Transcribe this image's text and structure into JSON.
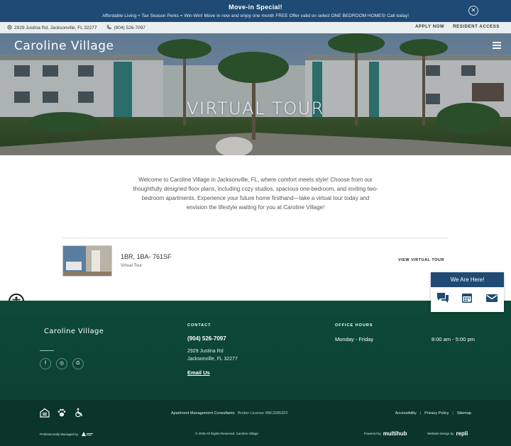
{
  "announcement": {
    "title": "Move-in Special!",
    "text": "Affordable Living + Tax Season Perks = Win-Win! Move in now and enjoy one month FREE Offer valid on select ONE BEDROOM HOMES! Call today!",
    "close_icon": "close-icon",
    "close_glyph": "✕"
  },
  "utility": {
    "address": "2929 Justina Rd, Jacksonville, FL 32277",
    "phone": "(904) 526-7097",
    "apply": "APPLY NOW",
    "resident": "RESIDENT ACCESS"
  },
  "header": {
    "brand": "Caroline Village",
    "menu_icon": "hamburger-menu-icon"
  },
  "hero": {
    "title": "VIRTUAL TOUR"
  },
  "intro": {
    "text": "Welcome to Caroline Village in Jacksonville, FL, where comfort meets style! Choose from our thoughtfully designed floor plans, including cozy studios, spacious one-bedroom, and inviting two-bedroom apartments. Experience your future home firsthand—take a virtual tour today and envision the lifestyle waiting for you at Caroline Village!"
  },
  "tours": [
    {
      "name": "1BR, 1BA- 761SF",
      "subtitle": "Virtual Tour",
      "link": "VIEW VIRTUAL TOUR"
    }
  ],
  "chat": {
    "header": "We Are Here!",
    "icons": [
      "chat-icon",
      "calendar-icon",
      "mail-icon"
    ]
  },
  "footer": {
    "brand": "Caroline Village",
    "social": [
      "facebook-icon",
      "instagram-icon",
      "google-icon"
    ],
    "social_glyphs": [
      "f",
      "◎",
      "G"
    ],
    "contact": {
      "heading": "CONTACT",
      "phone": "(904) 526-7097",
      "address_line1": "2929 Justina Rd",
      "address_line2": "Jacksonville, FL 32277",
      "email": "Email Us"
    },
    "hours": {
      "heading": "OFFICE HOURS",
      "days": "Monday - Friday",
      "time": "8:00 am - 5:00 pm"
    },
    "bottom": {
      "icons": [
        "equal-housing-icon",
        "pet-friendly-icon",
        "wheelchair-accessible-icon"
      ],
      "consultants": "Apartment Management Consultants",
      "broker": "Broker License #BK3285323",
      "links": [
        "Accessibility",
        "Privacy Policy",
        "Sitemap"
      ],
      "managed_by": "Professionally Managed by",
      "copyright": "© 2026 All Rights Reserved. Caroline Village",
      "powered_by": "Powered by",
      "powered_brand": "multihub",
      "design_by": "Website Design by",
      "design_brand": "repli"
    }
  },
  "colors": {
    "announcement_bg": "#1f4a73",
    "footer_bg": "#0d4a37",
    "utility_bg": "#e9eef1"
  }
}
